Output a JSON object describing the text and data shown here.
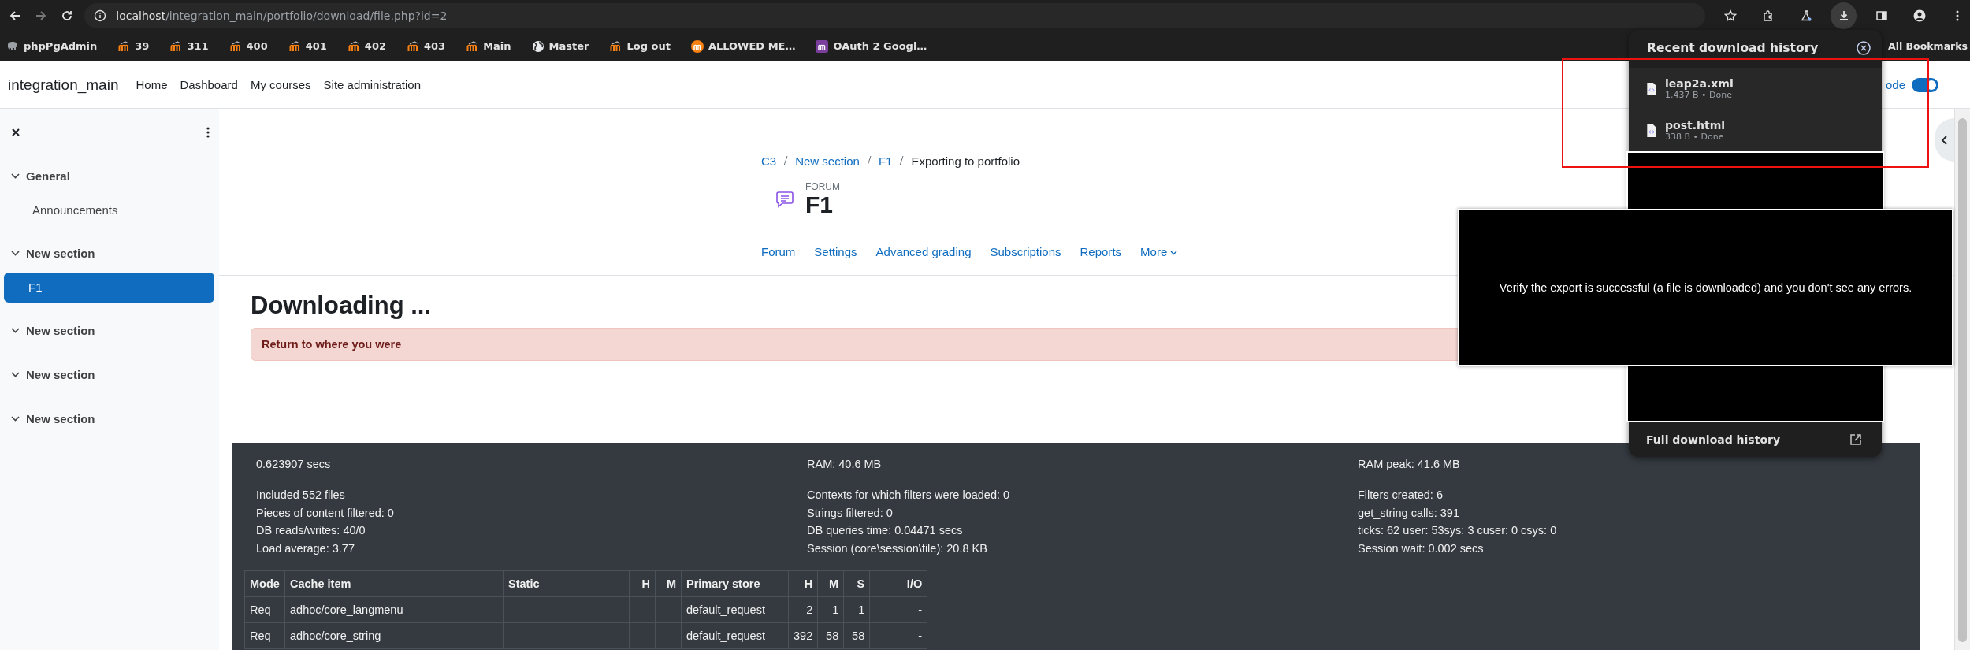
{
  "browser": {
    "url_host": "localhost",
    "url_path": "/integration_main/portfolio/download/file.php?id=2"
  },
  "bookmarks": [
    {
      "label": "phpPgAdmin",
      "kind": "elephant"
    },
    {
      "label": "39",
      "kind": "moodle"
    },
    {
      "label": "311",
      "kind": "moodle"
    },
    {
      "label": "400",
      "kind": "moodle"
    },
    {
      "label": "401",
      "kind": "moodle"
    },
    {
      "label": "402",
      "kind": "moodle"
    },
    {
      "label": "403",
      "kind": "moodle"
    },
    {
      "label": "Main",
      "kind": "moodle"
    },
    {
      "label": "Master",
      "kind": "globe"
    },
    {
      "label": "Log out",
      "kind": "moodle"
    },
    {
      "label": "ALLOWED ME…",
      "kind": "moodle-circle"
    },
    {
      "label": "OAuth 2 Googl…",
      "kind": "moodle-square"
    }
  ],
  "all_bookmarks": "All Bookmarks",
  "site_nav": {
    "brand": "integration_main",
    "links": [
      "Home",
      "Dashboard",
      "My courses",
      "Site administration"
    ],
    "edit_mode": {
      "label": "ode",
      "on": true
    }
  },
  "sidebar": {
    "sections": [
      {
        "title": "General",
        "expanded": true,
        "children": [
          {
            "label": "Announcements",
            "selected": false
          }
        ]
      },
      {
        "title": "New section",
        "expanded": true,
        "children": [
          {
            "label": "F1",
            "selected": true
          }
        ]
      },
      {
        "title": "New section",
        "expanded": true
      },
      {
        "title": "New section",
        "expanded": true
      },
      {
        "title": "New section",
        "expanded": true
      }
    ]
  },
  "breadcrumb": [
    {
      "label": "C3",
      "link": true
    },
    {
      "label": "New section",
      "link": true
    },
    {
      "label": "F1",
      "link": true
    },
    {
      "label": "Exporting to portfolio",
      "link": false
    }
  ],
  "activity": {
    "type_label": "FORUM",
    "title": "F1"
  },
  "tabs": [
    {
      "label": "Forum",
      "kind": "link",
      "selected": false
    },
    {
      "label": "Settings",
      "kind": "link",
      "selected": false
    },
    {
      "label": "Advanced grading",
      "kind": "link",
      "selected": false
    },
    {
      "label": "Subscriptions",
      "kind": "link",
      "selected": false
    },
    {
      "label": "Reports",
      "kind": "link",
      "selected": false
    },
    {
      "label": "More",
      "kind": "dropdown",
      "selected": false
    }
  ],
  "heading": "Downloading ...",
  "alert": {
    "link": "Return to where you were"
  },
  "performance": {
    "columns": [
      {
        "headline": "0.623907 secs",
        "lines": [
          "Included 552 files",
          "Pieces of content filtered: 0",
          "DB reads/writes: 40/0",
          "Load average: 3.77"
        ]
      },
      {
        "headline": "RAM: 40.6 MB",
        "lines": [
          "Contexts for which filters were loaded: 0",
          "Strings filtered: 0",
          "DB queries time: 0.04471 secs",
          "Session (core\\session\\file): 20.8 KB"
        ]
      },
      {
        "headline": "RAM peak: 41.6 MB",
        "lines": [
          "Filters created: 6",
          "get_string calls: 391",
          "ticks: 62 user: 53sys: 3 cuser: 0 csys: 0",
          "Session wait: 0.002 secs"
        ]
      }
    ],
    "cache_table": {
      "columns": [
        {
          "label": "Mode",
          "numeric": false
        },
        {
          "label": "Cache item",
          "numeric": false
        },
        {
          "label": "Static",
          "numeric": false
        },
        {
          "label": "H",
          "numeric": true
        },
        {
          "label": "M",
          "numeric": true
        },
        {
          "label": "Primary store",
          "numeric": false
        },
        {
          "label": "H",
          "numeric": true
        },
        {
          "label": "M",
          "numeric": true
        },
        {
          "label": "S",
          "numeric": true
        },
        {
          "label": "I/O",
          "numeric": true
        }
      ],
      "rows": [
        [
          "Req",
          "adhoc/core_langmenu",
          null,
          null,
          null,
          "default_request",
          "2",
          "1",
          "1",
          "-"
        ],
        [
          "Req",
          "adhoc/core_string",
          null,
          null,
          null,
          "default_request",
          "392",
          "58",
          "58",
          "-"
        ]
      ]
    }
  },
  "downloads": {
    "title": "Recent download history",
    "items": [
      {
        "name": "leap2a.xml",
        "status": "1,437 B • Done"
      },
      {
        "name": "post.html",
        "status": "338 B • Done"
      }
    ],
    "footer": "Full download history"
  },
  "instruction": "Verify the export is successful (a file is downloaded) and you don't see any errors."
}
